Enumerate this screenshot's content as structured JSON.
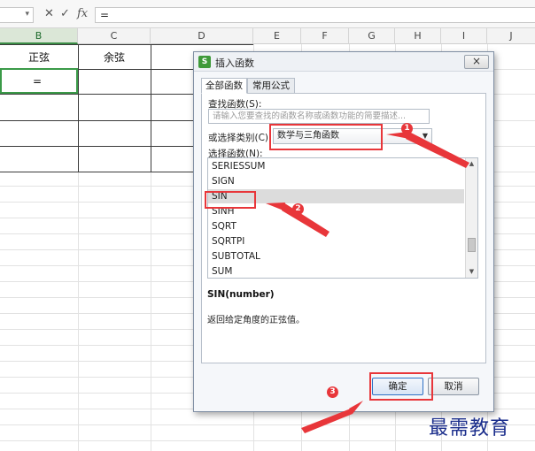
{
  "formula_bar": {
    "name_box_dropdown": "▾",
    "cancel_glyph": "✕",
    "confirm_glyph": "✓",
    "fx_label": "fx",
    "formula_value": "="
  },
  "columns": [
    "B",
    "C",
    "D",
    "E",
    "F",
    "G",
    "H",
    "I",
    "J"
  ],
  "sheet": {
    "b_header": "正弦",
    "c_header": "余弦",
    "b_value": "="
  },
  "dialog": {
    "title": "插入函数",
    "logo": "S",
    "close_glyph": "×",
    "tabs": [
      "全部函数",
      "常用公式"
    ],
    "search_label": "查找函数(S):",
    "search_placeholder": "请输入您要查找的函数名称或函数功能的简要描述...",
    "category_label": "或选择类别(C):",
    "category_value": "数学与三角函数",
    "category_arrow": "▼",
    "function_list_label": "选择函数(N):",
    "functions": [
      "SERIESSUM",
      "SIGN",
      "SIN",
      "SINH",
      "SQRT",
      "SQRTPI",
      "SUBTOTAL",
      "SUM"
    ],
    "selected_function": "SIN",
    "scroll_up": "▲",
    "scroll_down": "▼",
    "syntax": "SIN(number)",
    "description": "返回给定角度的正弦值。",
    "ok_label": "确定",
    "cancel_label": "取消"
  },
  "annotations": [
    "1",
    "2",
    "3"
  ],
  "watermark": "最需教育",
  "colors": {
    "annotation_red": "#e8363a",
    "selection_green": "#3a9a48",
    "watermark_blue": "#1b2e8c"
  }
}
